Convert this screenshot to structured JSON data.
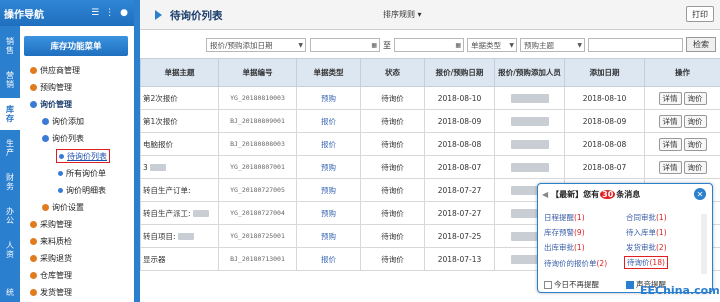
{
  "left_header": {
    "title": "操作导航"
  },
  "vtabs": [
    "销售",
    "营销",
    "库存",
    "生产",
    "财务",
    "办公",
    "人资",
    "统"
  ],
  "menu_head": "库存功能菜单",
  "tree": [
    {
      "label": "供应商管理"
    },
    {
      "label": "预购管理"
    },
    {
      "label": "询价管理"
    },
    {
      "label": "询价添加"
    },
    {
      "label": "询价列表"
    },
    {
      "label": "待询价列表"
    },
    {
      "label": "所有询价单"
    },
    {
      "label": "询价明细表"
    },
    {
      "label": "询价设置"
    },
    {
      "label": "采购管理"
    },
    {
      "label": "来料质检"
    },
    {
      "label": "采购退货"
    },
    {
      "label": "仓库管理"
    },
    {
      "label": "发货管理"
    }
  ],
  "topbar": {
    "title": "待询价列表",
    "sort": "排序规则",
    "print": "打印"
  },
  "filters": {
    "date_type": "报价/预购添加日期",
    "sep": "至",
    "bill_type": "单据类型",
    "subject": "预购主题",
    "search": "检索"
  },
  "table": {
    "headers": [
      "单据主题",
      "单据编号",
      "单据类型",
      "状态",
      "报价/预购日期",
      "报价/预购添加人员",
      "添加日期",
      "操作"
    ],
    "rows": [
      {
        "subject": "第2次报价",
        "no": "YG_20180810003",
        "type": "预购",
        "status": "待询价",
        "date": "2018-08-10",
        "added": "2018-08-10"
      },
      {
        "subject": "第1次报价",
        "no": "BJ_20180809001",
        "type": "报价",
        "status": "待询价",
        "date": "2018-08-09",
        "added": "2018-08-09"
      },
      {
        "subject": "电脑报价",
        "no": "BJ_20180808003",
        "type": "报价",
        "status": "待询价",
        "date": "2018-08-08",
        "added": "2018-08-08"
      },
      {
        "subject": "3",
        "no": "YG_20180807001",
        "type": "预购",
        "status": "待询价",
        "date": "2018-08-07",
        "added": "2018-08-07"
      },
      {
        "subject": "转自生产订单:",
        "no": "YG_20180727005",
        "type": "预购",
        "status": "待询价",
        "date": "2018-07-27",
        "added": ""
      },
      {
        "subject": "转自生产派工:",
        "no": "YG_20180727004",
        "type": "预购",
        "status": "待询价",
        "date": "2018-07-27",
        "added": ""
      },
      {
        "subject": "转自项目:",
        "no": "YG_20180725001",
        "type": "预购",
        "status": "待询价",
        "date": "2018-07-25",
        "added": ""
      },
      {
        "subject": "显示器",
        "no": "BJ_20180713001",
        "type": "报价",
        "status": "待询价",
        "date": "2018-07-13",
        "added": ""
      }
    ],
    "btn_detail": "详情",
    "btn_inquiry": "询价"
  },
  "popup": {
    "head_pre": "【最新】您有",
    "head_count": "30",
    "head_post": "条消息",
    "items": [
      {
        "label": "日程提醒",
        "count": "(1)"
      },
      {
        "label": "合同审批",
        "count": "(1)"
      },
      {
        "label": "库存预警",
        "count": "(9)"
      },
      {
        "label": "待入库单",
        "count": "(1)"
      },
      {
        "label": "出库审批",
        "count": "(1)"
      },
      {
        "label": "发货审批",
        "count": "(2)"
      },
      {
        "label": "待询价的报价单",
        "count": "(2)"
      },
      {
        "label": "待询价",
        "count": "(18)"
      }
    ],
    "check1": "今日不再提醒",
    "check2": "声音提醒"
  },
  "watermark": "EEChina.com"
}
